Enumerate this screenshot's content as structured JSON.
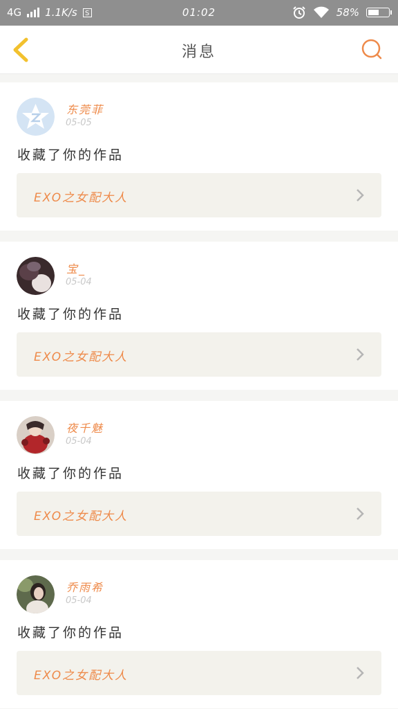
{
  "status_bar": {
    "network": "4G",
    "speed": "1.1K/s",
    "sim_icon": "S",
    "time": "01:02",
    "battery": "58%",
    "battery_level": 0.58
  },
  "header": {
    "title": "消息"
  },
  "messages": [
    {
      "name": "东莞菲",
      "date": "05-05",
      "action": "收藏了你的作品",
      "work": "EXO之女配大人",
      "avatar": "qzone-star-avatar"
    },
    {
      "name": "宝_",
      "date": "05-04",
      "action": "收藏了你的作品",
      "work": "EXO之女配大人",
      "avatar": "dark-portrait-avatar"
    },
    {
      "name": "夜千魅",
      "date": "05-04",
      "action": "收藏了你的作品",
      "work": "EXO之女配大人",
      "avatar": "red-illustration-avatar"
    },
    {
      "name": "乔雨希",
      "date": "05-04",
      "action": "收藏了你的作品",
      "work": "EXO之女配大人",
      "avatar": "girl-photo-avatar"
    }
  ],
  "colors": {
    "accent": "#ee8a4a",
    "back_icon": "#f2c12e",
    "card_bg": "#f3f2ec",
    "page_bg": "#f5f5f3"
  }
}
